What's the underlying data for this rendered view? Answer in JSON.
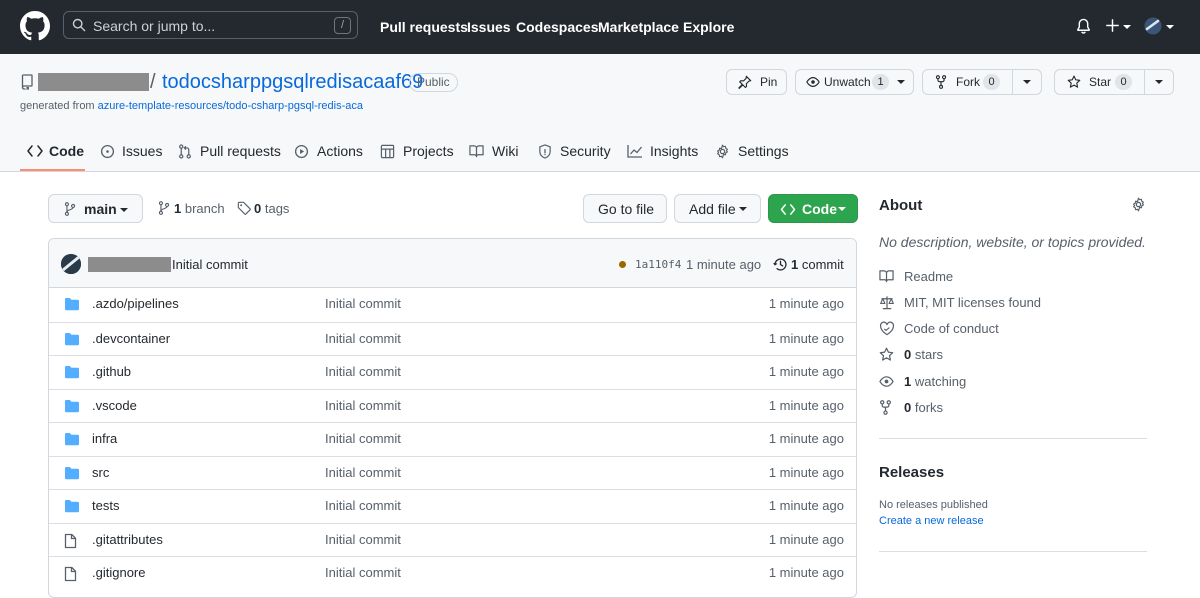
{
  "header": {
    "search_placeholder": "Search or jump to...",
    "search_shortcut": "/",
    "nav": [
      "Pull requests",
      "Issues",
      "Codespaces",
      "Marketplace",
      "Explore"
    ]
  },
  "repo": {
    "name": "todocsharppgsqlredisacaaf69",
    "separator": "/",
    "visibility": "Public",
    "generated_prefix": "generated from ",
    "generated_link": "azure-template-resources/todo-csharp-pgsql-redis-aca",
    "actions": {
      "pin": "Pin",
      "unwatch": "Unwatch",
      "watch_count": "1",
      "fork": "Fork",
      "fork_count": "0",
      "star": "Star",
      "star_count": "0"
    },
    "tabs": [
      "Code",
      "Issues",
      "Pull requests",
      "Actions",
      "Projects",
      "Wiki",
      "Security",
      "Insights",
      "Settings"
    ]
  },
  "toolbar": {
    "branch": "main",
    "branch_count": "1",
    "branch_label": "branch",
    "tag_count": "0",
    "tag_label": "tags",
    "go_to_file": "Go to file",
    "add_file": "Add file",
    "code": "Code"
  },
  "commit": {
    "message": "Initial commit",
    "sha": "1a110f4",
    "time": "1 minute ago",
    "count": "1",
    "count_label": "commit"
  },
  "files": [
    {
      "name": ".azdo/pipelines",
      "type": "folder",
      "message": "Initial commit",
      "time": "1 minute ago"
    },
    {
      "name": ".devcontainer",
      "type": "folder",
      "message": "Initial commit",
      "time": "1 minute ago"
    },
    {
      "name": ".github",
      "type": "folder",
      "message": "Initial commit",
      "time": "1 minute ago"
    },
    {
      "name": ".vscode",
      "type": "folder",
      "message": "Initial commit",
      "time": "1 minute ago"
    },
    {
      "name": "infra",
      "type": "folder",
      "message": "Initial commit",
      "time": "1 minute ago"
    },
    {
      "name": "src",
      "type": "folder",
      "message": "Initial commit",
      "time": "1 minute ago"
    },
    {
      "name": "tests",
      "type": "folder",
      "message": "Initial commit",
      "time": "1 minute ago"
    },
    {
      "name": ".gitattributes",
      "type": "file",
      "message": "Initial commit",
      "time": "1 minute ago"
    },
    {
      "name": ".gitignore",
      "type": "file",
      "message": "Initial commit",
      "time": "1 minute ago"
    }
  ],
  "about": {
    "title": "About",
    "description": "No description, website, or topics provided.",
    "readme": "Readme",
    "license": "MIT, MIT licenses found",
    "conduct": "Code of conduct",
    "stars_count": "0",
    "stars_label": "stars",
    "watching_count": "1",
    "watching_label": "watching",
    "forks_count": "0",
    "forks_label": "forks"
  },
  "releases": {
    "title": "Releases",
    "none": "No releases published",
    "create": "Create a new release"
  },
  "colors": {
    "header_bg": "#24292f",
    "link": "#0969da",
    "primary_green": "#2da44e",
    "tab_underline": "#fd8c73",
    "folder": "#54aeff"
  }
}
